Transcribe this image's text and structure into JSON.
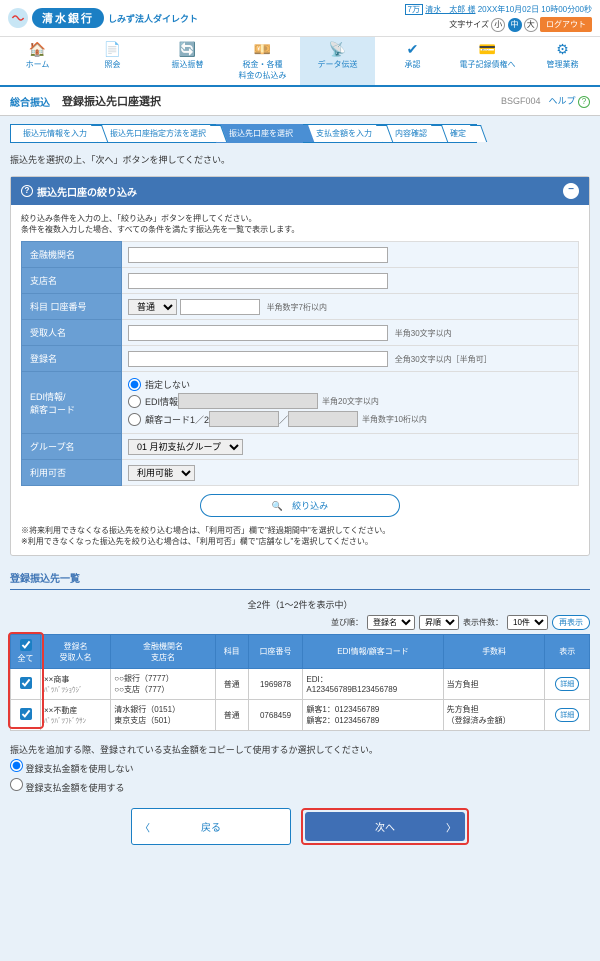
{
  "header": {
    "bank_name": "清水銀行",
    "sub_title": "しみず法人ダイレクト",
    "user_badge": "7万",
    "user_name": "清水　太郎 様",
    "timestamp": "20XX年10月02日 10時00分00秒",
    "font_label": "文字サイズ",
    "font_s": "小",
    "font_m": "中",
    "font_l": "大",
    "logout": "ログアウト"
  },
  "nav": [
    {
      "icon": "🏠",
      "label": "ホーム"
    },
    {
      "icon": "📄",
      "label": "照会"
    },
    {
      "icon": "🔄",
      "label": "振込振替"
    },
    {
      "icon": "💴",
      "label": "税金・各種\n料金の払込み"
    },
    {
      "icon": "📡",
      "label": "データ伝送"
    },
    {
      "icon": "✔",
      "label": "承認"
    },
    {
      "icon": "💳",
      "label": "電子記録債権へ"
    },
    {
      "icon": "⚙",
      "label": "管理業務"
    }
  ],
  "page": {
    "category": "総合振込",
    "title": "登録振込先口座選択",
    "code": "BSGF004",
    "help": "ヘルプ"
  },
  "steps": [
    "振込元情報を入力",
    "振込先口座指定方法を選択",
    "振込先口座を選択",
    "支払金額を入力",
    "内容確認",
    "確定"
  ],
  "active_step": 2,
  "instruction": "振込先を選択の上、「次へ」ボタンを押してください。",
  "filter": {
    "title": "振込先口座の絞り込み",
    "note1": "絞り込み条件を入力の上、「絞り込み」ボタンを押してください。",
    "note2": "条件を複数入力した場合、すべての条件を満たす振込先を一覧で表示します。",
    "labels": {
      "bank": "金融機関名",
      "branch": "支店名",
      "acct": "科目 口座番号",
      "payee": "受取人名",
      "regname": "登録名",
      "edi": "EDI情報/\n顧客コード",
      "group": "グループ名",
      "avail": "利用可否"
    },
    "acct_hint": "半角数字7桁以内",
    "payee_hint": "半角30文字以内",
    "regname_hint": "全角30文字以内［半角可］",
    "edi_none": "指定しない",
    "edi_info": "EDI情報",
    "edi_hint1": "半角20文字以内",
    "edi_code": "顧客コード1／2",
    "edi_sep": "／",
    "edi_hint2": "半角数字10桁以内",
    "acct_type": "普通",
    "group_val": "01 月初支払グループ",
    "avail_val": "利用可能",
    "filter_btn": "🔍　絞り込み",
    "warn1": "※将来利用できなくなる振込先を絞り込む場合は、「利用可否」欄で\"経過期間中\"を選択してください。",
    "warn2": "※利用できなくなった振込先を絞り込む場合は、「利用可否」欄で\"店舗なし\"を選択してください。"
  },
  "list": {
    "title": "登録振込先一覧",
    "count": "全2件（1～2件を表示中）",
    "sort_label": "並び順：",
    "sort_val": "登録名",
    "order_val": "昇順",
    "rows_label": "表示件数：",
    "rows_val": "10件",
    "redisplay": "再表示",
    "headers": {
      "all": "全て",
      "name": "登録名\n受取人名",
      "bank": "金融機関名\n支店名",
      "type": "科目",
      "acct": "口座番号",
      "edi": "EDI情報/顧客コード",
      "fee": "手数料",
      "show": "表示"
    },
    "rows": [
      {
        "name": "××商事",
        "kana": "ﾊﾞﾂﾊﾞﾂｼｮｳｼﾞ",
        "bank": "○○銀行（7777）",
        "branch": "○○支店（777）",
        "type": "普通",
        "acct": "1969878",
        "edi": "EDI：\nA123456789B123456789",
        "fee": "当方負担",
        "detail": "詳細"
      },
      {
        "name": "××不動産",
        "kana": "ﾊﾞﾂﾊﾞﾂﾌﾄﾞｳｻﾝ",
        "bank": "清水銀行（0151）",
        "branch": "東京支店（501）",
        "type": "普通",
        "acct": "0768459",
        "edi": "顧客1：0123456789\n顧客2：0123456789",
        "fee": "先方負担\n（登録済み金額）",
        "detail": "詳細"
      }
    ]
  },
  "copy": {
    "instruction": "振込先を追加する際、登録されている支払金額をコピーして使用するか選択してください。",
    "opt1": "登録支払金額を使用しない",
    "opt2": "登録支払金額を使用する"
  },
  "buttons": {
    "back": "戻る",
    "next": "次へ"
  }
}
